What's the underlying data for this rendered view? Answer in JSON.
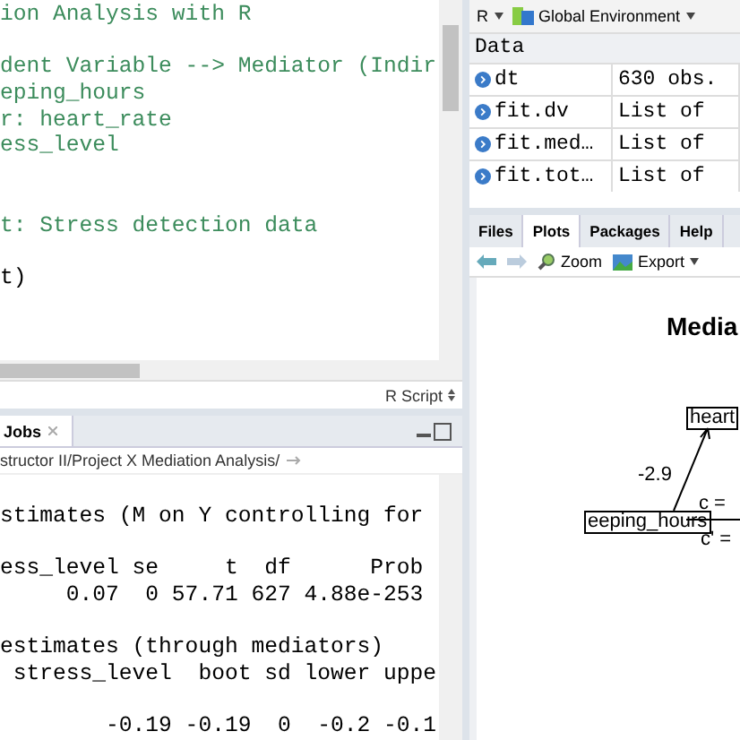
{
  "editor": {
    "lines": [
      {
        "kind": "comment",
        "text": "ion Analysis with R"
      },
      {
        "kind": "blank"
      },
      {
        "kind": "comment",
        "text": "dent Variable --> Mediator (Indir"
      },
      {
        "kind": "comment",
        "text": "eping_hours"
      },
      {
        "kind": "comment",
        "text": "r: heart_rate"
      },
      {
        "kind": "comment",
        "text": "ess_level"
      },
      {
        "kind": "blank"
      },
      {
        "kind": "blank"
      },
      {
        "kind": "comment",
        "text": "t: Stress detection data"
      },
      {
        "kind": "blank"
      },
      {
        "kind": "code",
        "text": "t)"
      }
    ],
    "file_type": "R Script"
  },
  "console": {
    "tab": "Jobs",
    "path": "structor II/Project X Mediation Analysis/",
    "lines": [
      {
        "kind": "blank"
      },
      {
        "kind": "text",
        "text": "stimates (M on Y controlling for"
      },
      {
        "kind": "blank"
      },
      {
        "kind": "text",
        "text": "ess_level se     t  df      Prob"
      },
      {
        "kind": "text",
        "text": "     0.07  0 57.71 627 4.88e-253"
      },
      {
        "kind": "blank"
      },
      {
        "kind": "text",
        "text": "estimates (through mediators)"
      },
      {
        "kind": "text",
        "text": " stress_level  boot sd lower uppe"
      },
      {
        "kind": "blank"
      },
      {
        "kind": "text",
        "text": "        -0.19 -0.19  0  -0.2 -0.1"
      }
    ]
  },
  "environment": {
    "language": "R",
    "scope": "Global Environment",
    "section": "Data",
    "rows": [
      {
        "name": "dt",
        "value": "630 obs."
      },
      {
        "name": "fit.dv",
        "value": "List of"
      },
      {
        "name": "fit.med…",
        "value": "List of"
      },
      {
        "name": "fit.tot…",
        "value": "List of"
      }
    ]
  },
  "files_pane": {
    "tabs": [
      {
        "label": "Files",
        "selected": false
      },
      {
        "label": "Plots",
        "selected": true
      },
      {
        "label": "Packages",
        "selected": false
      },
      {
        "label": "Help",
        "selected": false
      }
    ],
    "toolbar": [
      "Zoom",
      "Export"
    ],
    "plot": {
      "title": "Media",
      "mediator": "heart",
      "predictor": "eeping_hours",
      "path_a": "-2.9",
      "path_c": "c =",
      "path_c_prime": "c' ="
    }
  }
}
